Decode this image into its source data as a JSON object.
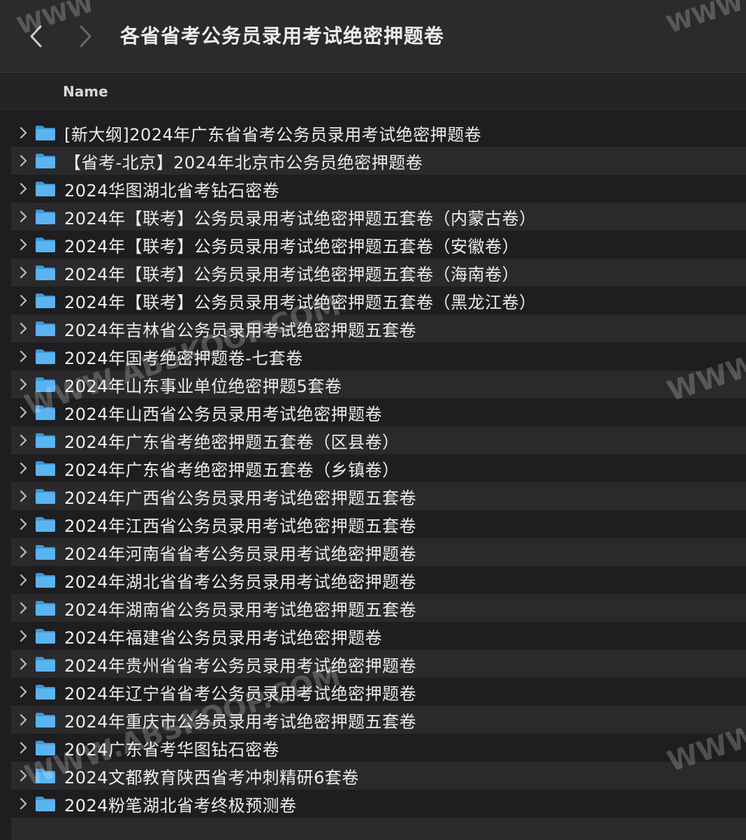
{
  "window": {
    "title": "各省省考公务员录用考试绝密押题卷"
  },
  "toolbar": {
    "back_icon": "chevron-left-icon",
    "forward_icon": "chevron-right-icon"
  },
  "columns": {
    "name": "Name"
  },
  "files": [
    {
      "name": "[新大纲]2024年广东省省考公务员录用考试绝密押题卷"
    },
    {
      "name": "【省考-北京】2024年北京市公务员绝密押题卷"
    },
    {
      "name": "2024华图湖北省考钻石密卷"
    },
    {
      "name": "2024年【联考】公务员录用考试绝密押题五套卷（内蒙古卷）"
    },
    {
      "name": "2024年【联考】公务员录用考试绝密押题五套卷（安徽卷）"
    },
    {
      "name": "2024年【联考】公务员录用考试绝密押题五套卷（海南卷）"
    },
    {
      "name": "2024年【联考】公务员录用考试绝密押题五套卷（黑龙江卷）"
    },
    {
      "name": "2024年吉林省公务员录用考试绝密押题五套卷"
    },
    {
      "name": "2024年国考绝密押题卷-七套卷"
    },
    {
      "name": "2024年山东事业单位绝密押题5套卷"
    },
    {
      "name": "2024年山西省公务员录用考试绝密押题卷"
    },
    {
      "name": "2024年广东省考绝密押题五套卷（区县卷）"
    },
    {
      "name": "2024年广东省考绝密押题五套卷（乡镇卷）"
    },
    {
      "name": "2024年广西省公务员录用考试绝密押题五套卷"
    },
    {
      "name": "2024年江西省公务员录用考试绝密押题五套卷"
    },
    {
      "name": "2024年河南省省考公务员录用考试绝密押题卷"
    },
    {
      "name": "2024年湖北省省考公务员录用考试绝密押题卷"
    },
    {
      "name": "2024年湖南省公务员录用考试绝密押题五套卷"
    },
    {
      "name": "2024年福建省公务员录用考试绝密押题卷"
    },
    {
      "name": "2024年贵州省省考公务员录用考试绝密押题卷"
    },
    {
      "name": "2024年辽宁省省考公务员录用考试绝密押题卷"
    },
    {
      "name": "2024年重庆市公务员录用考试绝密押题五套卷"
    },
    {
      "name": "2024广东省考华图钻石密卷"
    },
    {
      "name": "2024文都教育陕西省考冲刺精研6套卷"
    },
    {
      "name": "2024粉笔湖北省考终极预测卷"
    }
  ],
  "icons": {
    "folder": "folder-icon",
    "disclosure": "chevron-right-icon"
  },
  "colors": {
    "folder_blue": "#5ab4f0",
    "background": "#1e1e21"
  },
  "watermarks": [
    {
      "text": "WWW.ABSKOOP.COM"
    },
    {
      "text": "WWW.ABSKOOP.COM"
    },
    {
      "text": "WWW"
    },
    {
      "text": "WWW"
    },
    {
      "text": "WWW"
    },
    {
      "text": "WWW"
    }
  ]
}
